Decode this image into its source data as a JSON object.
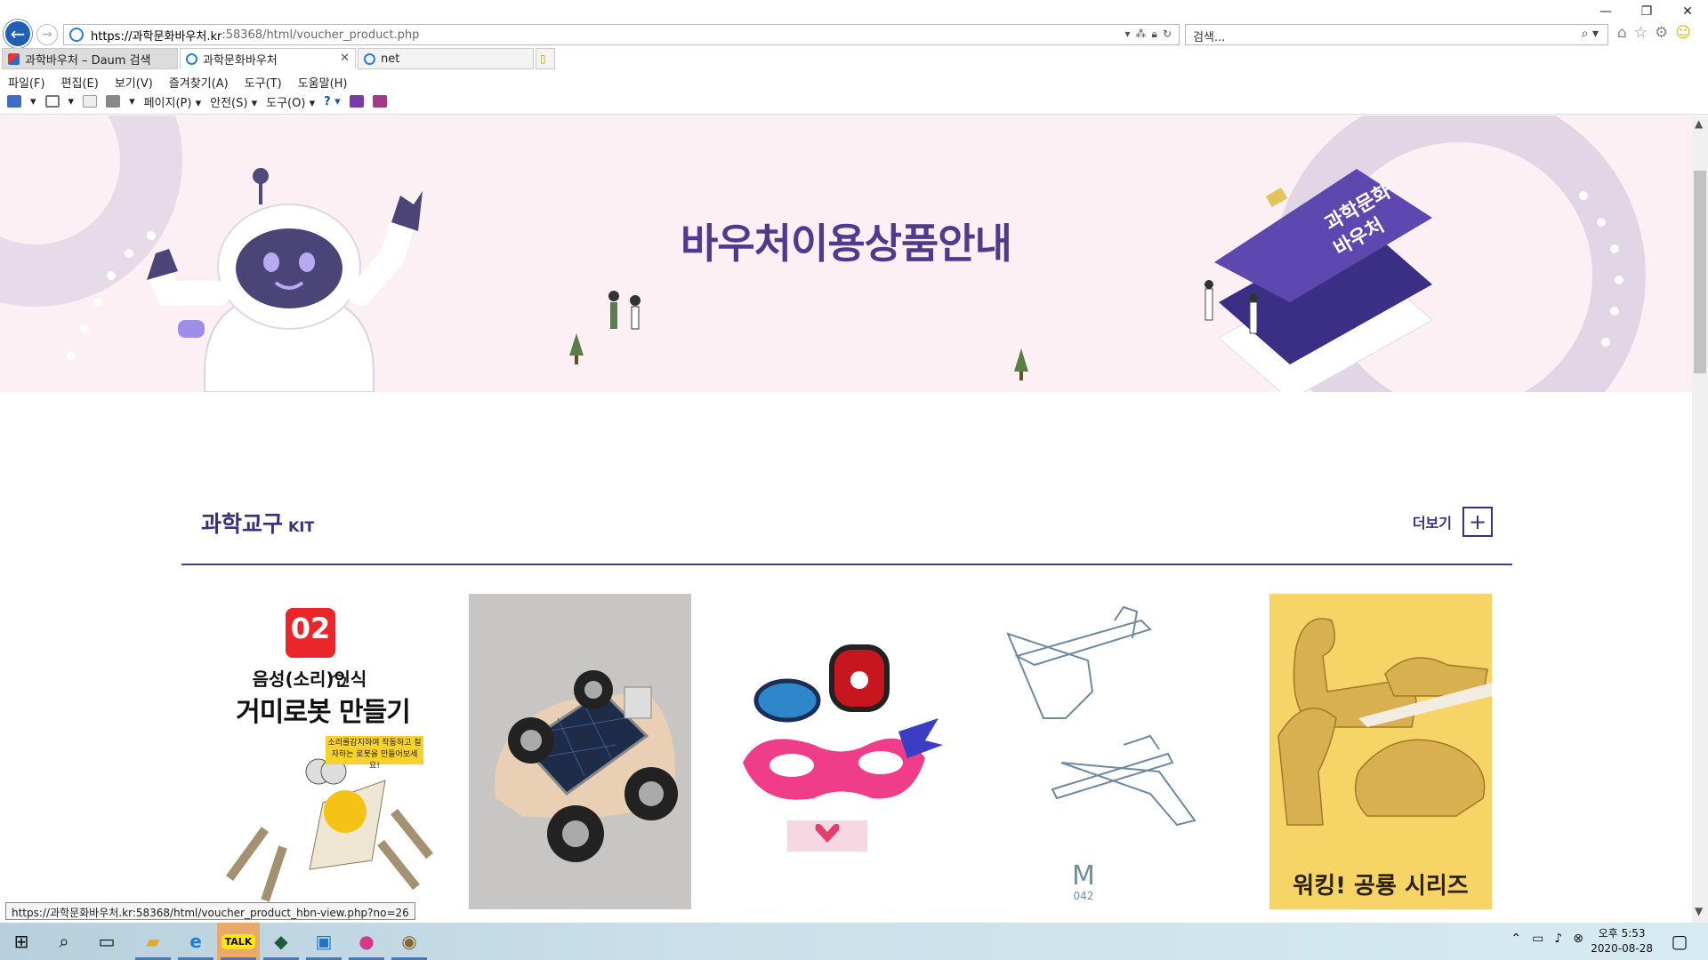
{
  "browser": {
    "url_host": "https://과학문화바우처.kr",
    "url_path": ":58368/html/voucher_product.php",
    "search_placeholder": "검색...",
    "tabs": [
      {
        "label": "과학바우처 – Daum 검색",
        "active": false
      },
      {
        "label": "과학문화바우처",
        "active": true
      },
      {
        "label": "net",
        "active": false
      }
    ],
    "menu": [
      "파일(F)",
      "편집(E)",
      "보기(V)",
      "즐겨찾기(A)",
      "도구(T)",
      "도움말(H)"
    ],
    "commands": [
      "페이지(P)",
      "안전(S)",
      "도구(O)"
    ]
  },
  "hero": {
    "title": "바우처이용상품안내",
    "card_text": "과학문화\n바우처"
  },
  "section": {
    "title": "과학교구",
    "subtitle": "KIT",
    "more_label": "더보기",
    "more_symbol": "+"
  },
  "products": [
    {
      "badge": "02",
      "line1": "음성(소리)인식",
      "line2": "거미로봇 만들기",
      "bubble": "소리를감지하여 작동하고 질자하는 로봇을 만들어보세요!"
    },
    {
      "name": "solar-car-kit"
    },
    {
      "name": "mask-kit"
    },
    {
      "brand": "M",
      "brand_sub": "042"
    },
    {
      "caption": "워킹! 공룡 시리즈"
    }
  ],
  "status_url": "https://과학문화바우처.kr:58368/html/voucher_product_hbn-view.php?no=26",
  "taskbar": {
    "time": "오후 5:53",
    "date": "2020-08-28"
  },
  "colors": {
    "brand_purple": "#4e3a8e",
    "hero_bg": "#fcf0f5",
    "dino_bg": "#f8d66a"
  }
}
